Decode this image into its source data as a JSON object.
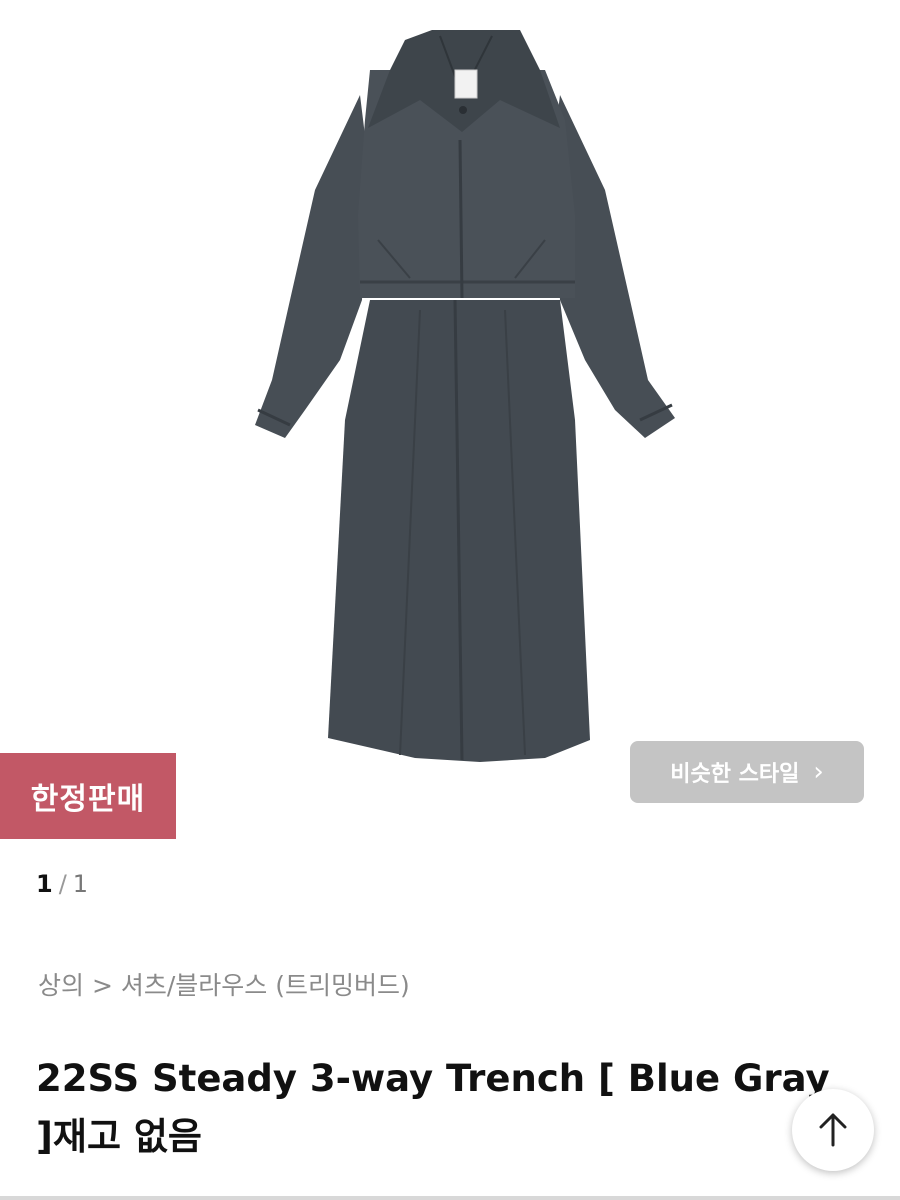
{
  "product": {
    "image_alt": "Blue gray trench coat dress with cropped jacket",
    "image_colors": {
      "garment": "#434a51",
      "garment_shadow": "#363c42",
      "garment_highlight": "#505860"
    }
  },
  "badge": {
    "label": "한정판매",
    "color": "#c25866"
  },
  "similar_style": {
    "label": "비슷한 스타일",
    "chevron": "›",
    "color": "#c4c4c4"
  },
  "pager": {
    "current": "1",
    "separator": "/",
    "total": "1"
  },
  "breadcrumb": {
    "category": "상의",
    "arrow": ">",
    "subcategory": "셔츠/블라우스",
    "brand": "(트리밍버드)"
  },
  "title": {
    "text": "22SS Steady 3-way Trench [ Blue Gray ]재고 없음"
  },
  "scroll_top": {
    "icon": "arrow-up-icon"
  }
}
